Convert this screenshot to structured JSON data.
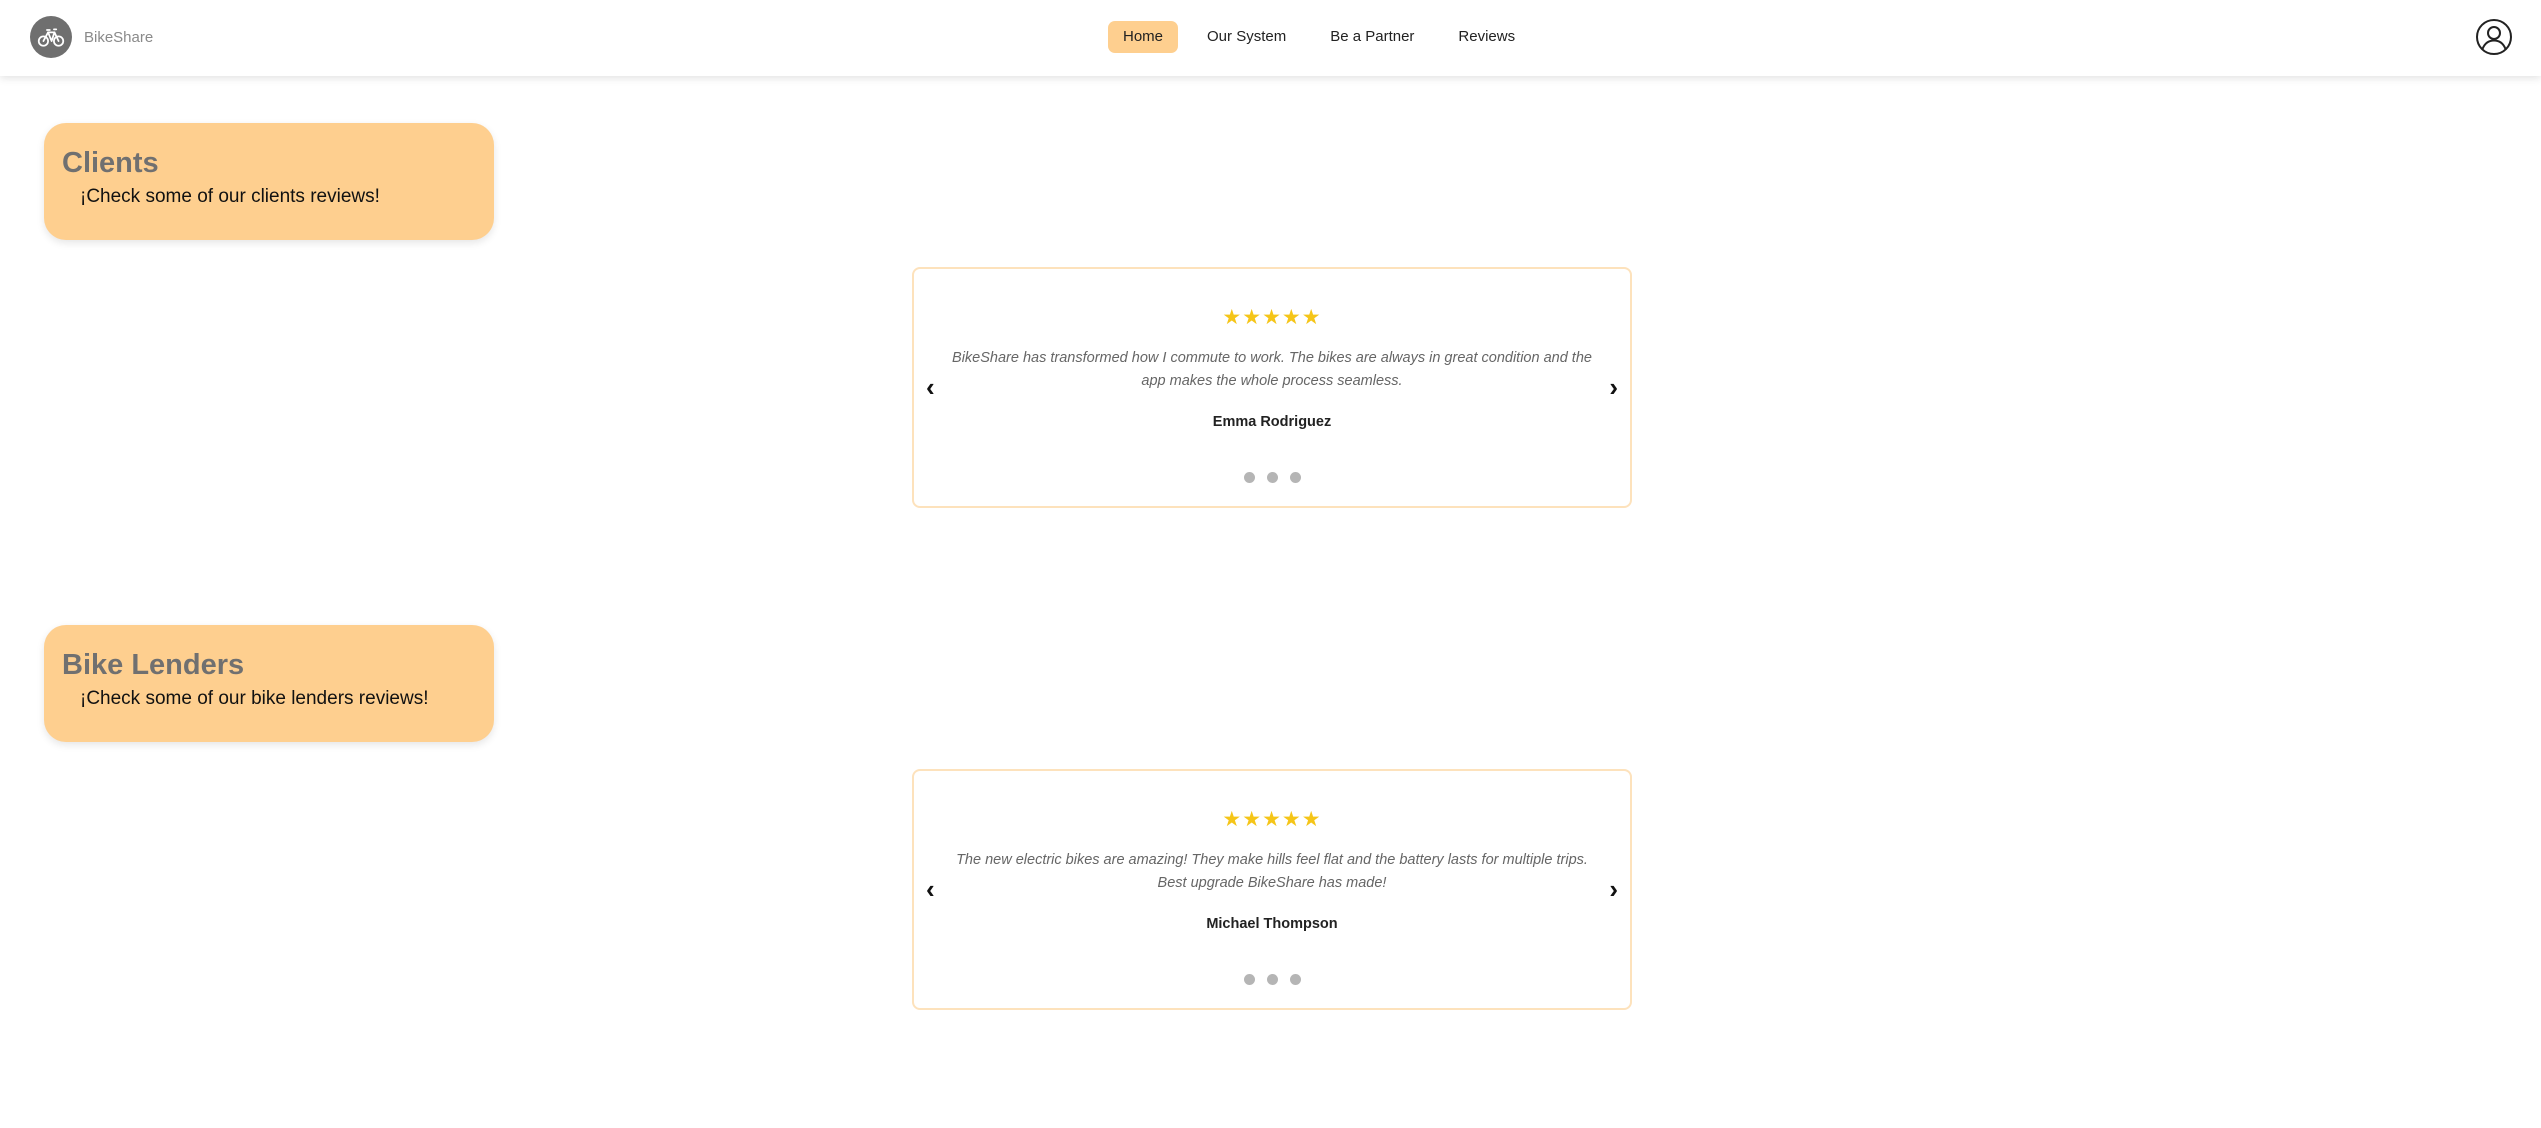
{
  "header": {
    "brand": "BikeShare",
    "nav": [
      "Home",
      "Our System",
      "Be a Partner",
      "Reviews"
    ],
    "active_nav": "Home"
  },
  "sections": {
    "clients": {
      "title": "Clients",
      "subtitle": "¡Check some of our clients reviews!",
      "review": {
        "stars": "★★★★★",
        "text": "BikeShare has transformed how I commute to work. The bikes are always in great condition and the app makes the whole process seamless.",
        "author": "Emma Rodriguez",
        "prev": "‹",
        "next": "›"
      }
    },
    "lenders": {
      "title": "Bike Lenders",
      "subtitle": "¡Check some of our bike lenders reviews!",
      "review": {
        "stars": "★★★★★",
        "text": "The new electric bikes are amazing! They make hills feel flat and the battery lasts for multiple trips. Best upgrade BikeShare has made!",
        "author": "Michael Thompson",
        "prev": "‹",
        "next": "›"
      }
    }
  },
  "colors": {
    "accent": "#fecf8f",
    "star": "#f5c518",
    "dot": "#b5b5b5",
    "card_border": "#fde2bc"
  },
  "icons": {
    "logo": "bicycle-icon",
    "user": "user-account-icon"
  }
}
